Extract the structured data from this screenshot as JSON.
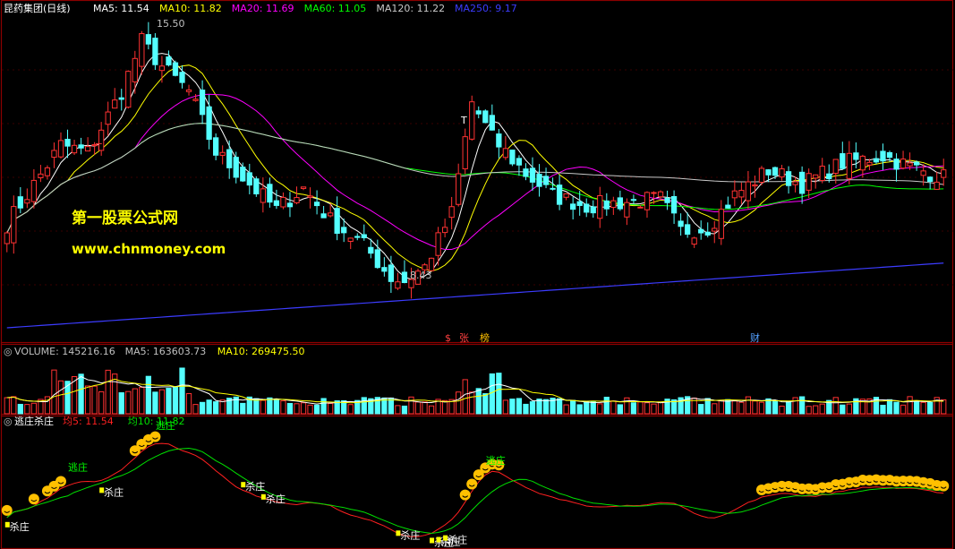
{
  "colors": {
    "up": "#ff3232",
    "down": "#54ffff",
    "ma5": "#ffffff",
    "ma10": "#ffff00",
    "ma20": "#ff00ff",
    "ma60": "#00ff00",
    "ma120": "#c8c8c8",
    "ma250": "#3c3cff",
    "vol_ma5": "#ffffff",
    "vol_ma10": "#ffff00",
    "ind_line5": "#ff2020",
    "ind_line10": "#00e000",
    "frame": "#8b0000",
    "label_text": "#c0c0c0",
    "watermark": "#ffff00",
    "escape_text": "#00ff00",
    "kill_text": "#ffffff",
    "smiley": "#ffc000"
  },
  "price_panel": {
    "stock_title": "昆药集团(日线)",
    "ma_labels": [
      {
        "text": "MA5: 11.54",
        "color": "#ffffff"
      },
      {
        "text": "MA10: 11.82",
        "color": "#ffff00"
      },
      {
        "text": "MA20: 11.69",
        "color": "#ff00ff"
      },
      {
        "text": "MA60: 11.05",
        "color": "#00ff00"
      },
      {
        "text": "MA120: 11.22",
        "color": "#c8c8c8"
      },
      {
        "text": "MA250: 9.17",
        "color": "#3c3cff"
      }
    ],
    "high_label": "15.50",
    "low_label": "8.43",
    "watermark_line1": "第一股票公式网",
    "watermark_line2": "www.chnmoney.com",
    "event_marks": [
      {
        "text": "$",
        "color": "#ff4040"
      },
      {
        "text": "张",
        "color": "#ff4040"
      },
      {
        "text": "榜",
        "color": "#ffc000"
      },
      {
        "text": "财",
        "color": "#54a0ff"
      }
    ],
    "t_marks": [
      "T",
      "T"
    ]
  },
  "volume_panel": {
    "labels": [
      {
        "text": "VOLUME: 145216.16",
        "color": "#c0c0c0"
      },
      {
        "text": "MA5: 163603.73",
        "color": "#c0c0c0"
      },
      {
        "text": "MA10: 269475.50",
        "color": "#ffff00"
      }
    ]
  },
  "indicator_panel": {
    "name": "逃庄杀庄",
    "labels": [
      {
        "text": "均5: 11.54",
        "color": "#ff2020"
      },
      {
        "text": "均10: 11.82",
        "color": "#00e000"
      }
    ],
    "escape_label": "逃庄",
    "kill_label": "杀庄"
  },
  "chart_data": {
    "type": "candlestick",
    "price_range": [
      7.0,
      16.0
    ],
    "bars": 140,
    "anchors_close": [
      [
        0,
        10.2
      ],
      [
        8,
        12.4
      ],
      [
        12,
        12.2
      ],
      [
        17,
        13.9
      ],
      [
        20,
        15.3
      ],
      [
        23,
        14.6
      ],
      [
        27,
        13.9
      ],
      [
        31,
        12.2
      ],
      [
        35,
        11.5
      ],
      [
        40,
        10.6
      ],
      [
        44,
        11.2
      ],
      [
        48,
        10.3
      ],
      [
        53,
        9.6
      ],
      [
        57,
        8.7
      ],
      [
        59,
        8.6
      ],
      [
        62,
        9.0
      ],
      [
        66,
        10.5
      ],
      [
        69,
        13.6
      ],
      [
        72,
        12.6
      ],
      [
        77,
        11.6
      ],
      [
        81,
        11.0
      ],
      [
        86,
        10.7
      ],
      [
        91,
        10.8
      ],
      [
        97,
        10.9
      ],
      [
        100,
        10.0
      ],
      [
        104,
        10.1
      ],
      [
        108,
        11.0
      ],
      [
        113,
        11.7
      ],
      [
        118,
        11.3
      ],
      [
        124,
        11.9
      ],
      [
        130,
        12.1
      ],
      [
        134,
        11.8
      ],
      [
        139,
        11.5
      ]
    ],
    "volume_range": [
      0,
      1000000
    ],
    "indicator_range": [
      8.0,
      16.0
    ],
    "escape_marks_at": [
      8,
      21,
      70
    ],
    "kill_marks_at": [
      0,
      14,
      35,
      38,
      58,
      63,
      64,
      65
    ],
    "smiley_marks_at": [
      0,
      4,
      6,
      7,
      8,
      19,
      20,
      21,
      22,
      68,
      69,
      70,
      71,
      72,
      73,
      112,
      113,
      114,
      115,
      116,
      117,
      118,
      119,
      120,
      121,
      122,
      123,
      124,
      125,
      126,
      127,
      128,
      129,
      130,
      131,
      132,
      133,
      134,
      135,
      136,
      137,
      138,
      139
    ]
  }
}
